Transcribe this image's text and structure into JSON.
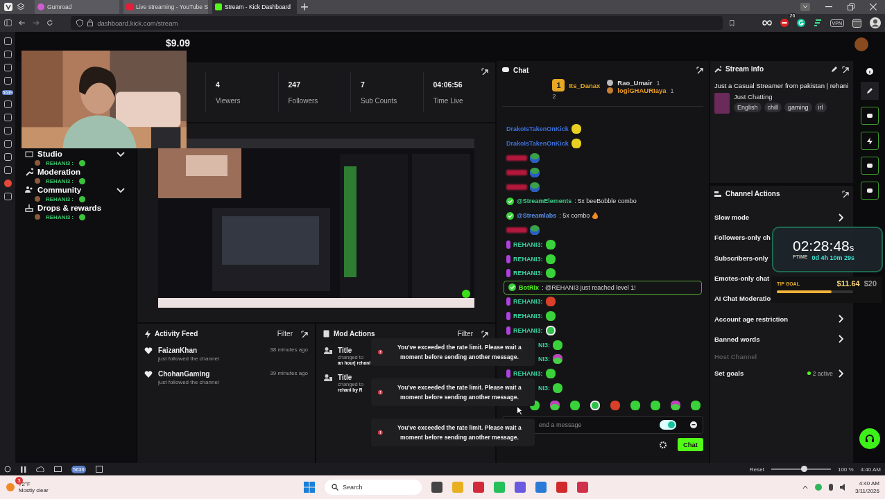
{
  "browser": {
    "tabs": [
      {
        "label": "Gumroad",
        "kind": "gumroad",
        "selected": false
      },
      {
        "label": "Live streaming - YouTube S",
        "kind": "youtube",
        "selected": false
      },
      {
        "label": "Stream - Kick Dashboard",
        "kind": "kick",
        "selected": true
      }
    ],
    "url": "dashboard.kick.com/stream",
    "extension_badge": "26",
    "vpn_label": "VPN",
    "panel_badge": "5639"
  },
  "header": {
    "balance": "$9.09"
  },
  "sidebar": {
    "items": [
      {
        "label": "Studio",
        "chevron": true,
        "overlay": "REHANI3 :"
      },
      {
        "label": "Moderation",
        "chevron": false,
        "overlay": "REHANI3 :"
      },
      {
        "label": "Community",
        "chevron": true,
        "overlay": "REHANI3 :"
      },
      {
        "label": "Drops & rewards",
        "chevron": false,
        "overlay": "REHANI3 :"
      }
    ]
  },
  "stats": [
    {
      "value": "4",
      "label": "Viewers"
    },
    {
      "value": "247",
      "label": "Followers"
    },
    {
      "value": "7",
      "label": "Sub Counts"
    },
    {
      "value": "04:06:56",
      "label": "Time Live"
    }
  ],
  "activity_feed": {
    "title": "Activity Feed",
    "filter": "Filter",
    "items": [
      {
        "name": "FaizanKhan",
        "detail": "just followed the channel",
        "time": "38 minutes ago"
      },
      {
        "name": "ChohanGaming",
        "detail": "just followed the channel",
        "time": "39 minutes ago"
      }
    ]
  },
  "mod_actions": {
    "title": "Mod Actions",
    "filter": "Filter",
    "items": [
      {
        "title": "Title",
        "lines": [
          "changed to",
          "an hour| rehani"
        ]
      },
      {
        "title": "Title",
        "lines": [
          "changed to",
          "rehani by R"
        ]
      }
    ]
  },
  "toasts": [
    "You've exceeded the rate limit. Please wait a moment before sending another message.",
    "You've exceeded the rate limit. Please wait a moment before sending another message.",
    "You've exceeded the rate limit. Please wait a moment before sending another message."
  ],
  "chat": {
    "title": "Chat",
    "leaders": [
      {
        "rank": "1",
        "name": "Its_Danax",
        "count": "2"
      },
      {
        "name": "Rao_Umair",
        "count": "1"
      },
      {
        "name": "logiGHAURIaya",
        "count": "1"
      }
    ],
    "messages": [
      {
        "kind": "emote",
        "name": "DrakoIsTakenOnKick",
        "color": "#3d6fd8"
      },
      {
        "kind": "emote",
        "name": "DrakoIsTakenOnKick",
        "color": "#3d6fd8"
      },
      {
        "kind": "hidden",
        "color": "#b3183c"
      },
      {
        "kind": "hidden",
        "color": "#b3183c"
      },
      {
        "kind": "hidden",
        "color": "#b3183c"
      },
      {
        "kind": "bot",
        "name": "@StreamElements",
        "color": "#3fd08a",
        "text": ": 5x beeBobble combo"
      },
      {
        "kind": "bot",
        "name": "@Streamlabs",
        "color": "#5a8ee6",
        "text": ": 5x combo",
        "fire": true
      },
      {
        "kind": "hidden",
        "color": "#b3183c"
      },
      {
        "kind": "emote",
        "name": "REHANI3:",
        "color": "#3fd0a0",
        "badge": true
      },
      {
        "kind": "emote",
        "name": "REHANI3:",
        "color": "#3fd0a0",
        "badge": true
      },
      {
        "kind": "emote",
        "name": "REHANI3:",
        "color": "#3fd0a0",
        "badge": true
      },
      {
        "kind": "highlight",
        "name": "BotRix",
        "color": "#53fc18",
        "text": ": @REHANI3 just reached level 1!"
      },
      {
        "kind": "emote",
        "name": "REHANI3:",
        "color": "#3fd0a0",
        "badge": true
      },
      {
        "kind": "emote",
        "name": "REHANI3:",
        "color": "#3fd0a0",
        "badge": true
      },
      {
        "kind": "emote",
        "name": "REHANI3:",
        "color": "#3fd0a0",
        "badge": true
      },
      {
        "kind": "emote",
        "name": "NI3:",
        "color": "#3fd0a0",
        "badge": false
      },
      {
        "kind": "emote",
        "name": "NI3:",
        "color": "#3fd0a0",
        "badge": false
      },
      {
        "kind": "emote",
        "name": "REHANI3:",
        "color": "#3fd0a0",
        "badge": true
      },
      {
        "kind": "emote",
        "name": "NI3:",
        "color": "#3fd0a0",
        "badge": false
      }
    ],
    "placeholder": "end a message",
    "send": "Chat"
  },
  "stream_info": {
    "title": "Stream info",
    "description": "Just a Casual Streamer from pakistan | rehani",
    "category": "Just Chatting",
    "tags": [
      "English",
      "chill",
      "gaming",
      "irl"
    ]
  },
  "channel_actions": {
    "title": "Channel Actions",
    "items": [
      {
        "label": "Slow mode",
        "kind": "link",
        "disabled": false
      },
      {
        "label": "Followers-only ch",
        "kind": "plain",
        "disabled": false
      },
      {
        "label": "Subscribers-only",
        "kind": "plain",
        "disabled": false
      },
      {
        "label": "Emotes-only chat",
        "kind": "plain",
        "disabled": false
      },
      {
        "label": "AI Chat Moderatio",
        "kind": "plain",
        "disabled": false
      },
      {
        "label": "Account age restriction",
        "kind": "link",
        "disabled": false
      },
      {
        "label": "Banned words",
        "kind": "link",
        "disabled": false
      },
      {
        "label": "Host Channel",
        "kind": "plain",
        "disabled": true
      },
      {
        "label": "Set goals",
        "kind": "goals",
        "disabled": false,
        "status": "2 active"
      }
    ]
  },
  "uptime_widget": {
    "time": "02:28:48",
    "unit": "s",
    "label": "PTIME",
    "elapsed": "0d 4h 10m 29s"
  },
  "tip_goal": {
    "label": "TIP GOAL",
    "raised": "$11.64",
    "goal": "$20",
    "level": 0.72
  },
  "status_bar": {
    "badge": "5639",
    "reset": "Reset",
    "zoom": "100 %",
    "level": 0.55,
    "time": "4:40 AM"
  },
  "taskbar": {
    "temperature": "72°F",
    "weather": "Mostly clear",
    "weather_badge": "3",
    "search": "Search",
    "time": "4:40 AM",
    "date": "3/11/2026"
  }
}
